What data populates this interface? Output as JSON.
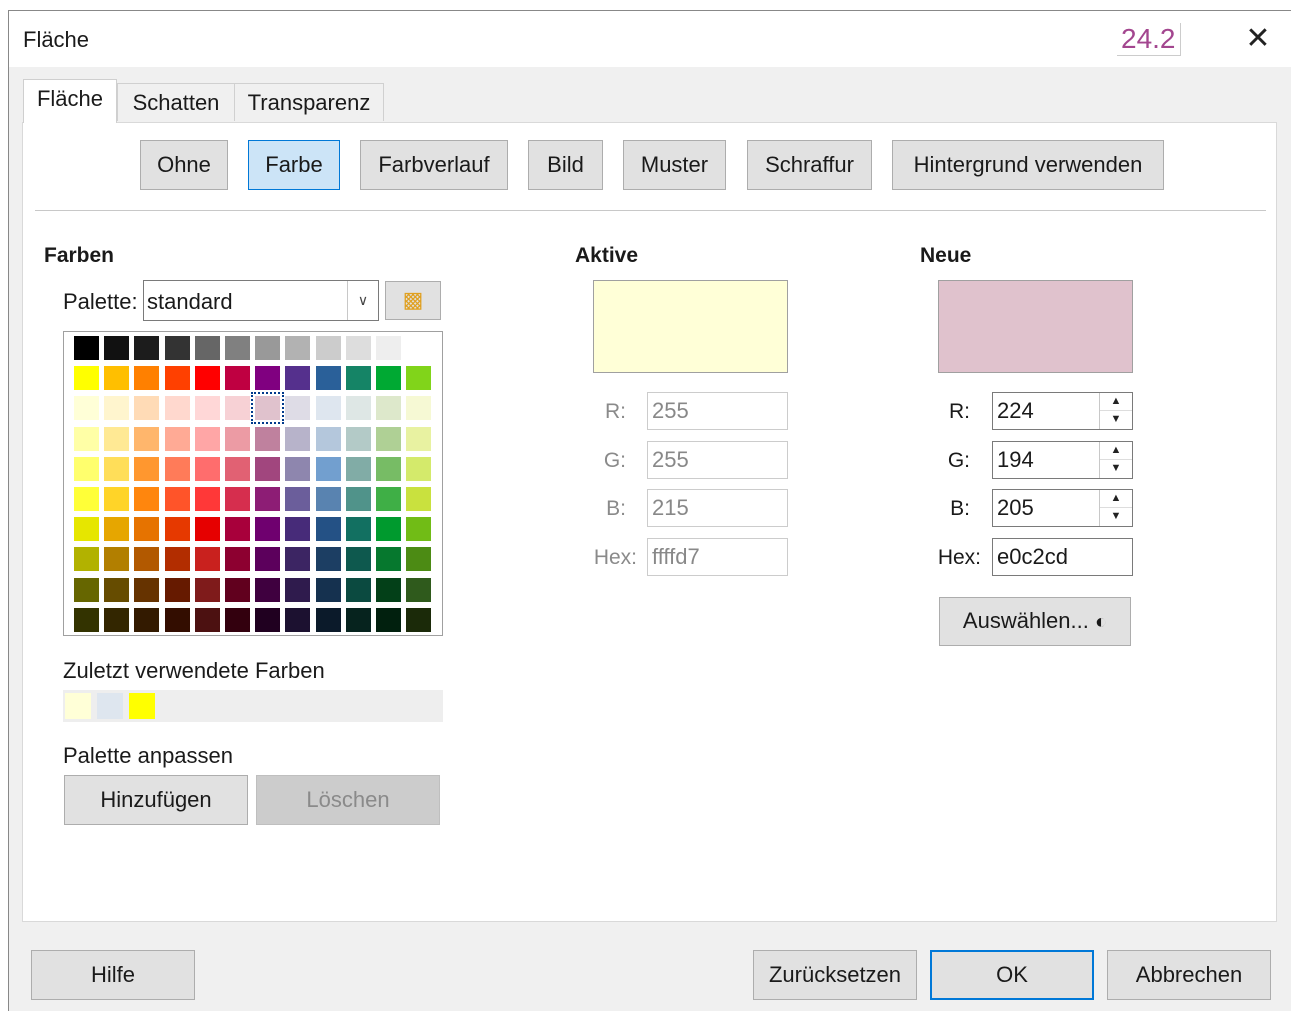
{
  "window": {
    "title": "Fläche",
    "version_badge": "24.2",
    "close_glyph": "✕"
  },
  "tabs": [
    {
      "label": "Fläche",
      "active": true
    },
    {
      "label": "Schatten",
      "active": false
    },
    {
      "label": "Transparenz",
      "active": false
    }
  ],
  "fill_types": [
    {
      "label": "Ohne",
      "selected": false
    },
    {
      "label": "Farbe",
      "selected": true
    },
    {
      "label": "Farbverlauf",
      "selected": false
    },
    {
      "label": "Bild",
      "selected": false
    },
    {
      "label": "Muster",
      "selected": false
    },
    {
      "label": "Schraffur",
      "selected": false
    },
    {
      "label": "Hintergrund verwenden",
      "selected": false
    }
  ],
  "colors": {
    "heading": "Farben",
    "palette_label": "Palette:",
    "palette_value": "standard",
    "palette_options_icon": "chevron-down",
    "palette_swatches": [
      [
        "#000000",
        "#111111",
        "#1c1c1c",
        "#333333",
        "#666666",
        "#808080",
        "#999999",
        "#b2b2b2",
        "#cccccc",
        "#dddddd",
        "#eeeeee",
        "#ffffff"
      ],
      [
        "#ffff00",
        "#ffbf00",
        "#ff8000",
        "#ff4000",
        "#ff0000",
        "#bf0041",
        "#800080",
        "#55308d",
        "#2a6099",
        "#158466",
        "#00a933",
        "#81d41a"
      ],
      [
        "#ffffd7",
        "#fff5ce",
        "#ffdbb6",
        "#ffd8ce",
        "#ffd7d7",
        "#f7d1d5",
        "#e0c2cd",
        "#dedce6",
        "#dee6ef",
        "#dee7e5",
        "#dde8cb",
        "#f6f9d4"
      ],
      [
        "#ffff a6",
        "#ffe994",
        "#ffb66c",
        "#ffaa95",
        "#ffa6a6",
        "#ec9ba4",
        "#bf819e",
        "#b7b3ca",
        "#b4c7dc",
        "#b3cac7",
        "#afd095",
        "#e8f2a1"
      ],
      [
        "#ffff6d",
        "#ffde59",
        "#ff972f",
        "#ff7b59",
        "#ff6d6d",
        "#e16173",
        "#a1467e",
        "#8e86ae",
        "#729fcf",
        "#81aca6",
        "#77bc65",
        "#d4ea6b"
      ],
      [
        "#ffff38",
        "#ffd428",
        "#ff860d",
        "#ff5429",
        "#ff3838",
        "#d62e4e",
        "#8d1d75",
        "#6b5e9b",
        "#5983b0",
        "#50938a",
        "#3faf46",
        "#c9e13e"
      ],
      [
        "#e6e600",
        "#e6a600",
        "#e67300",
        "#e63900",
        "#e60000",
        "#a8003b",
        "#6f006f",
        "#472b79",
        "#245185",
        "#127061",
        "#009a2e",
        "#71bc16"
      ],
      [
        "#b2b200",
        "#b27f00",
        "#b25900",
        "#b22d00",
        "#c9211e",
        "#8d0030",
        "#5c005c",
        "#3c2563",
        "#1c3e63",
        "#0e594e",
        "#06782e",
        "#4c8b14"
      ],
      [
        "#666600",
        "#664c00",
        "#663300",
        "#661a00",
        "#7f1b1b",
        "#61001e",
        "#3f003f",
        "#2f1b4d",
        "#15314f",
        "#0b4a40",
        "#034018",
        "#2f5a1c"
      ],
      [
        "#333300",
        "#332600",
        "#331a00",
        "#330d00",
        "#4c1111",
        "#33000e",
        "#200020",
        "#1c1130",
        "#0b1a2a",
        "#06231e",
        "#01200e",
        "#1b2a09"
      ]
    ],
    "selected_swatch": [
      2,
      6
    ],
    "recent_label": "Zuletzt verwendete Farben",
    "recent_colors": [
      "#ffffd7",
      "#dee6ef",
      "#ffff00"
    ],
    "customize_label": "Palette anpassen",
    "add_label": "Hinzufügen",
    "delete_label": "Löschen"
  },
  "active": {
    "heading": "Aktive",
    "color": "#ffffd7",
    "r_label": "R:",
    "r": "255",
    "g_label": "G:",
    "g": "255",
    "b_label": "B:",
    "b": "215",
    "hex_label": "Hex:",
    "hex": "ffffd7"
  },
  "new": {
    "heading": "Neue",
    "color": "#e0c2cd",
    "r_label": "R:",
    "r": "224",
    "g_label": "G:",
    "g": "194",
    "b_label": "B:",
    "b": "205",
    "hex_label": "Hex:",
    "hex": "e0c2cd",
    "pick_label": "Auswählen...",
    "pick_icon": "palette-icon"
  },
  "footer": {
    "help": "Hilfe",
    "reset": "Zurücksetzen",
    "ok": "OK",
    "cancel": "Abbrechen"
  }
}
